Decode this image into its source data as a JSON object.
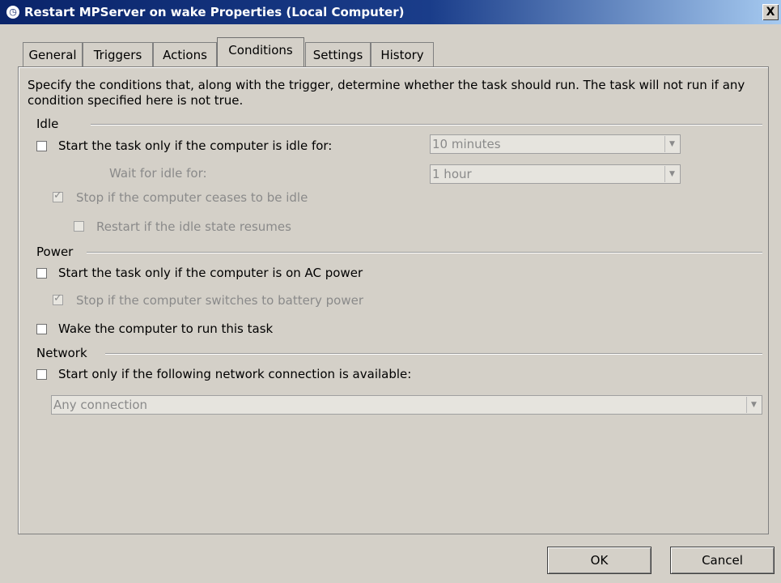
{
  "window": {
    "title": "Restart MPServer on wake Properties (Local Computer)",
    "close_label": "X"
  },
  "tabs": [
    {
      "label": "General"
    },
    {
      "label": "Triggers"
    },
    {
      "label": "Actions"
    },
    {
      "label": "Conditions"
    },
    {
      "label": "Settings"
    },
    {
      "label": "History"
    }
  ],
  "active_tab": "Conditions",
  "description": "Specify the conditions that, along with the trigger, determine whether the task should run.  The task will not run  if any condition specified here is not true.",
  "idle": {
    "group_label": "Idle",
    "start_if_idle": {
      "label": "Start the task only if the computer is idle for:",
      "checked": false
    },
    "idle_duration": {
      "value": "10 minutes"
    },
    "wait_label": "Wait for idle for:",
    "wait_duration": {
      "value": "1 hour"
    },
    "stop_if_ceases": {
      "label": "Stop if the computer ceases to be idle",
      "checked": true
    },
    "restart_if_resumes": {
      "label": "Restart if the idle state resumes",
      "checked": false
    }
  },
  "power": {
    "group_label": "Power",
    "ac_power": {
      "label": "Start the task only if the computer is on AC power",
      "checked": false
    },
    "battery_stop": {
      "label": "Stop if the computer switches to battery power",
      "checked": true
    },
    "wake": {
      "label": "Wake the computer to run this task",
      "checked": false
    }
  },
  "network": {
    "group_label": "Network",
    "start_only": {
      "label": "Start only if the following network connection is available:",
      "checked": false
    },
    "connection": {
      "value": "Any connection"
    }
  },
  "buttons": {
    "ok": "OK",
    "cancel": "Cancel"
  }
}
